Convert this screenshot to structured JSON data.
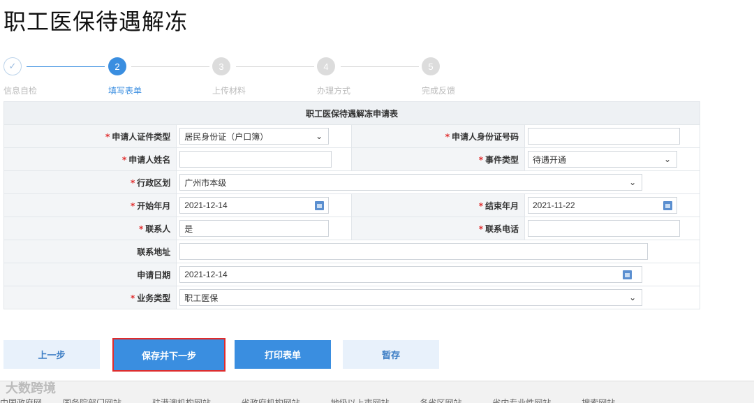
{
  "page": {
    "title": "职工医保待遇解冻"
  },
  "stepper": {
    "steps": [
      {
        "number": "✓",
        "label": "信息自检",
        "state": "done"
      },
      {
        "number": "2",
        "label": "填写表单",
        "state": "active"
      },
      {
        "number": "3",
        "label": "上传材料",
        "state": "todo"
      },
      {
        "number": "4",
        "label": "办理方式",
        "state": "todo"
      },
      {
        "number": "5",
        "label": "完成反馈",
        "state": "todo"
      }
    ]
  },
  "form": {
    "caption": "职工医保待遇解冻申请表",
    "required_mark": "*",
    "id_type": {
      "label": "申请人证件类型",
      "value": "居民身份证（户口簿）"
    },
    "id_number": {
      "label": "申请人身份证号码",
      "value": ""
    },
    "name": {
      "label": "申请人姓名",
      "value": ""
    },
    "event_type": {
      "label": "事件类型",
      "value": "待遇开通"
    },
    "district": {
      "label": "行政区划",
      "value": "广州市本级"
    },
    "start_month": {
      "label": "开始年月",
      "value": "2021-12-14"
    },
    "end_month": {
      "label": "结束年月",
      "value": "2021-11-22"
    },
    "contact": {
      "label": "联系人",
      "value": "是"
    },
    "phone": {
      "label": "联系电话",
      "value": ""
    },
    "address": {
      "label": "联系地址",
      "value": ""
    },
    "apply_date": {
      "label": "申请日期",
      "value": "2021-12-14"
    },
    "business_type": {
      "label": "业务类型",
      "value": "职工医保"
    }
  },
  "buttons": {
    "prev": "上一步",
    "save_next": "保存并下一步",
    "print": "打印表单",
    "draft": "暂存"
  },
  "footer": {
    "watermark": "大数跨境",
    "links": [
      "中国政府网",
      "国务院部门网站 ⌄",
      "驻港澳机构网站 ⌄",
      "省政府机构网站 ⌄",
      "地级以上市网站 ⌄",
      "各省区网站 ⌄",
      "省内专业性网站 ⌄",
      "搜索网站 ⌄"
    ]
  },
  "colors": {
    "primary": "#3a8ee0",
    "required": "#e02b2b",
    "highlight_border": "#e02b2b"
  }
}
